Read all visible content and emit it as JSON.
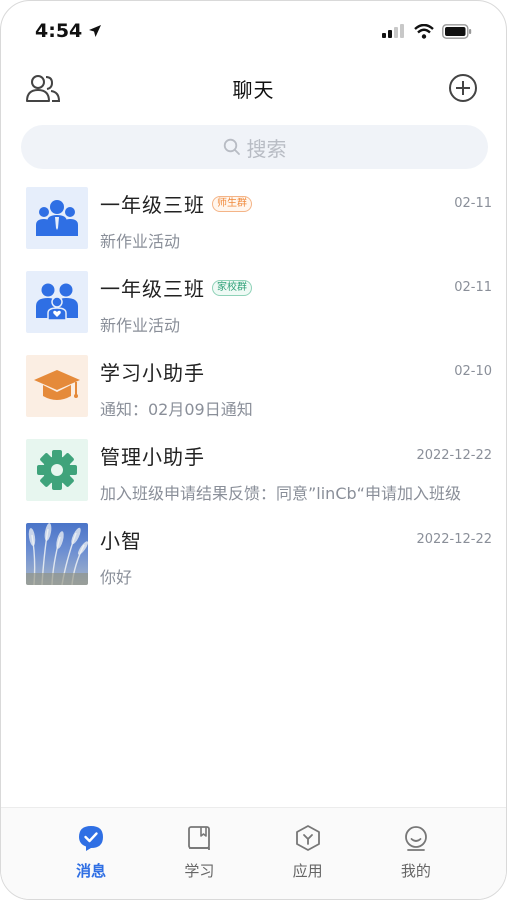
{
  "status_bar": {
    "time": "4:54"
  },
  "header": {
    "title": "聊天"
  },
  "search": {
    "placeholder": "搜索"
  },
  "chats": [
    {
      "name": "一年级三班",
      "tag": "师生群",
      "time": "02-11",
      "preview": "新作业活动",
      "avatar": "teacher-group"
    },
    {
      "name": "一年级三班",
      "tag": "家校群",
      "time": "02-11",
      "preview": "新作业活动",
      "avatar": "family-group"
    },
    {
      "name": "学习小助手",
      "tag": "",
      "time": "02-10",
      "preview": "通知：02月09日通知",
      "avatar": "graduation-cap"
    },
    {
      "name": "管理小助手",
      "tag": "",
      "time": "2022-12-22",
      "preview": "加入班级申请结果反馈：同意”linCb“申请加入班级",
      "avatar": "gear"
    },
    {
      "name": "小智",
      "tag": "",
      "time": "2022-12-22",
      "preview": "你好",
      "avatar": "photo"
    }
  ],
  "tabs": [
    {
      "label": "消息",
      "active": true
    },
    {
      "label": "学习",
      "active": false
    },
    {
      "label": "应用",
      "active": false
    },
    {
      "label": "我的",
      "active": false
    }
  ],
  "colors": {
    "accent": "#2f6fe4",
    "orange_tag": "#f08a3c",
    "green_tag": "#2fa178"
  }
}
